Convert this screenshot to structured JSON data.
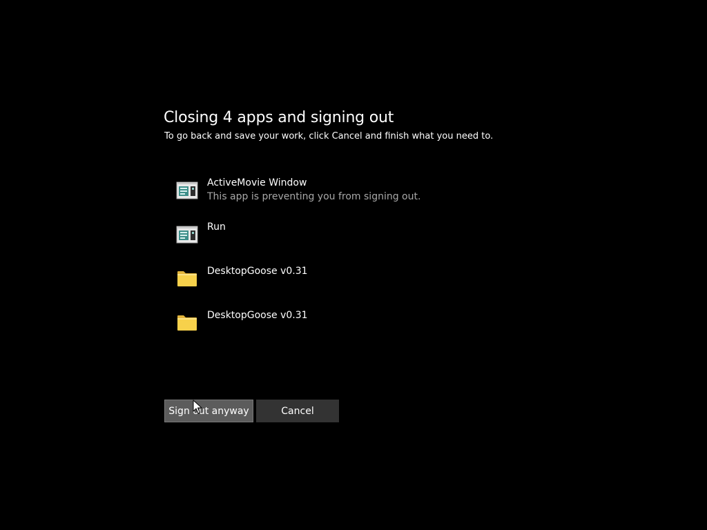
{
  "dialog": {
    "title": "Closing 4 apps and signing out",
    "subtitle": "To go back and save your work, click Cancel and finish what you need to."
  },
  "apps": [
    {
      "name": "ActiveMovie Window",
      "note": "This app is preventing you from signing out.",
      "icon": "window-app-icon"
    },
    {
      "name": "Run",
      "note": "",
      "icon": "window-app-icon"
    },
    {
      "name": "DesktopGoose v0.31",
      "note": "",
      "icon": "folder-icon"
    },
    {
      "name": "DesktopGoose v0.31",
      "note": "",
      "icon": "folder-icon"
    }
  ],
  "buttons": {
    "sign_out_label": "Sign out anyway",
    "cancel_label": "Cancel"
  },
  "colors": {
    "background": "#000000",
    "text": "#ffffff",
    "secondary_text": "#a8a8a8",
    "primary_button": "#5c5c5c",
    "secondary_button": "#333333",
    "folder": "#f7d14b"
  }
}
